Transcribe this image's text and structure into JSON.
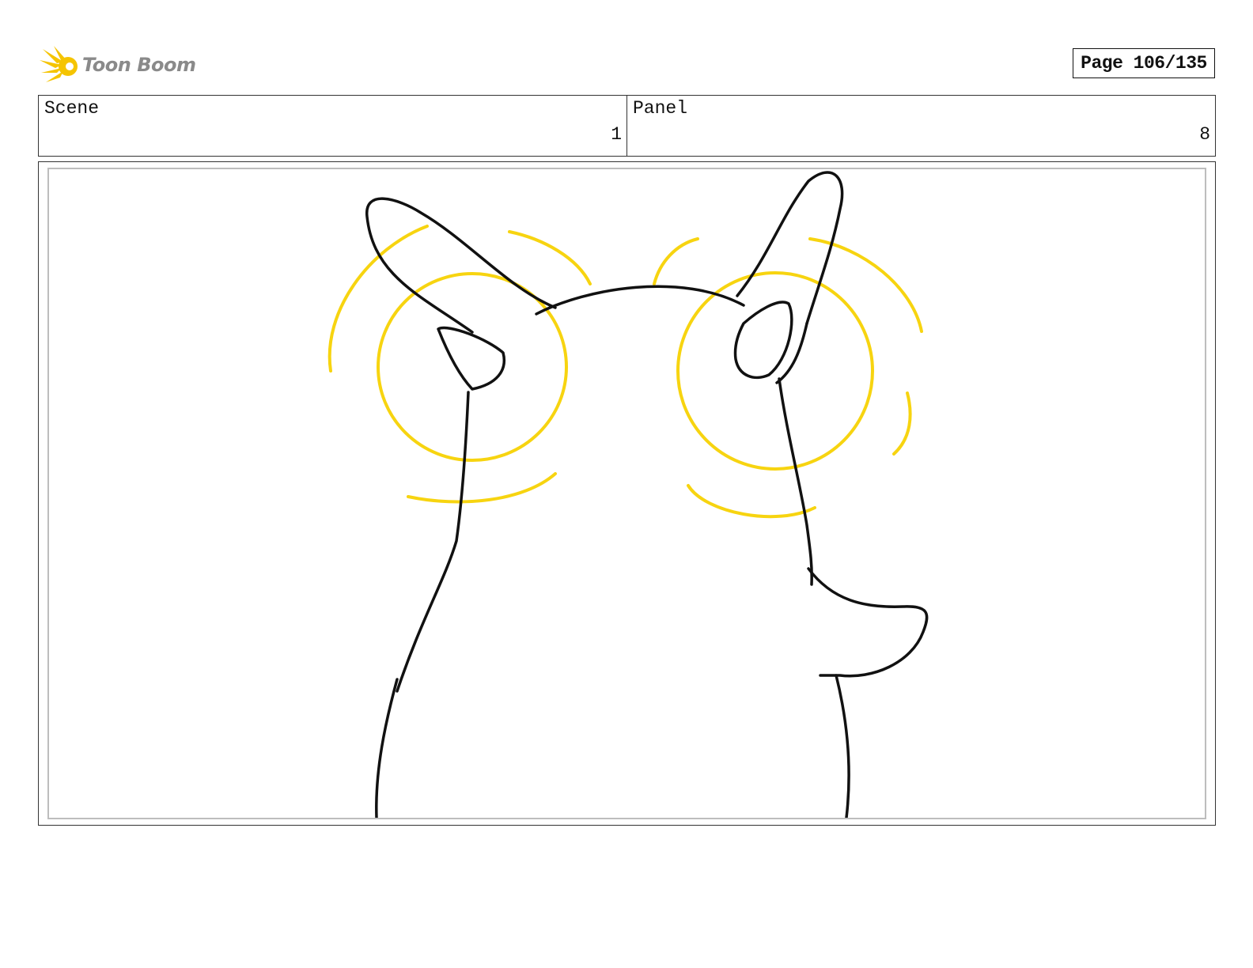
{
  "header": {
    "logo_text": "Toon Boom",
    "page_label": "Page 106/135"
  },
  "info": {
    "scene_label": "Scene",
    "scene_value": "1",
    "panel_label": "Panel",
    "panel_value": "8"
  },
  "colors": {
    "ink": "#111111",
    "highlight": "#f7d410",
    "logo_gold": "#f5c400",
    "logo_gray": "#8a8a8a",
    "frame_gray": "#bdbdbd"
  },
  "drawing": {
    "icons": [
      "toon-boom-logo-icon"
    ]
  }
}
